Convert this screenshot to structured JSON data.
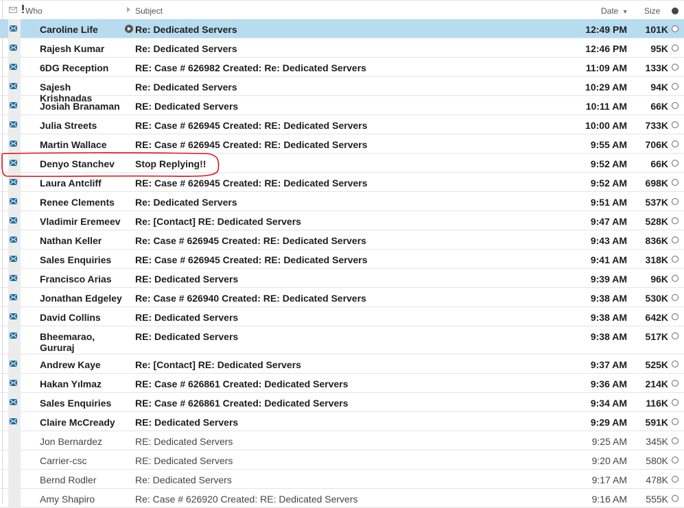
{
  "header": {
    "who_label": "Who",
    "subject_label": "Subject",
    "date_label": "Date",
    "sort_indicator": "▼",
    "size_label": "Size"
  },
  "colors": {
    "selected_row": "#b8dcef",
    "envelope_icon": "#1f6e9c",
    "annotation": "#e0101a"
  },
  "annotation": {
    "type": "hand-drawn-circle",
    "target": "Denyo Stanchev row"
  },
  "messages": [
    {
      "who": "Caroline Life",
      "subject": "Re: Dedicated Servers",
      "date": "12:49 PM",
      "size": "101K",
      "unread": true,
      "selected": true,
      "replied": true
    },
    {
      "who": "Rajesh Kumar",
      "subject": "Re: Dedicated Servers",
      "date": "12:46 PM",
      "size": "95K",
      "unread": true
    },
    {
      "who": "6DG Reception",
      "subject": "RE: Case # 626982 Created: Re: Dedicated Servers",
      "date": "11:09 AM",
      "size": "133K",
      "unread": true
    },
    {
      "who": "Sajesh Krishnadas",
      "subject": "Re: Dedicated Servers",
      "date": "10:29 AM",
      "size": "94K",
      "unread": true
    },
    {
      "who": "Josiah Branaman",
      "subject": "RE: Dedicated Servers",
      "date": "10:11 AM",
      "size": "66K",
      "unread": true
    },
    {
      "who": "Julia Streets",
      "subject": "RE: Case # 626945 Created: RE: Dedicated Servers",
      "date": "10:00 AM",
      "size": "733K",
      "unread": true
    },
    {
      "who": "Martin Wallace",
      "subject": "RE: Case # 626945 Created: RE: Dedicated Servers",
      "date": "9:55 AM",
      "size": "706K",
      "unread": true
    },
    {
      "who": "Denyo Stanchev",
      "subject": "Stop Replying!!",
      "date": "9:52 AM",
      "size": "66K",
      "unread": true,
      "circled": true
    },
    {
      "who": "Laura Antcliff",
      "subject": "RE: Case # 626945 Created: RE: Dedicated Servers",
      "date": "9:52 AM",
      "size": "698K",
      "unread": true
    },
    {
      "who": "Renee Clements",
      "subject": "Re: Dedicated Servers",
      "date": "9:51 AM",
      "size": "537K",
      "unread": true
    },
    {
      "who": "Vladimir Eremeev",
      "subject": "Re: [Contact] RE: Dedicated Servers",
      "date": "9:47 AM",
      "size": "528K",
      "unread": true
    },
    {
      "who": "Nathan Keller",
      "subject": "Re: Case # 626945 Created: RE: Dedicated Servers",
      "date": "9:43 AM",
      "size": "836K",
      "unread": true
    },
    {
      "who": "Sales Enquiries",
      "subject": "RE: Case # 626945 Created: RE: Dedicated Servers",
      "date": "9:41 AM",
      "size": "318K",
      "unread": true
    },
    {
      "who": "Francisco Arias",
      "subject": "RE: Dedicated Servers",
      "date": "9:39 AM",
      "size": "96K",
      "unread": true
    },
    {
      "who": "Jonathan Edgeley",
      "subject": "Re: Case # 626940 Created: RE: Dedicated Servers",
      "date": "9:38 AM",
      "size": "530K",
      "unread": true
    },
    {
      "who": "David Collins",
      "subject": "RE: Dedicated Servers",
      "date": "9:38 AM",
      "size": "642K",
      "unread": true
    },
    {
      "who": "Bheemarao, Gururaj",
      "subject": "RE: Dedicated Servers",
      "date": "9:38 AM",
      "size": "517K",
      "unread": true,
      "tall": true
    },
    {
      "who": "Andrew Kaye",
      "subject": "Re: [Contact] RE: Dedicated Servers",
      "date": "9:37 AM",
      "size": "525K",
      "unread": true
    },
    {
      "who": "Hakan Yılmaz",
      "subject": "RE: Case # 626861 Created: Dedicated Servers",
      "date": "9:36 AM",
      "size": "214K",
      "unread": true
    },
    {
      "who": "Sales Enquiries",
      "subject": "RE: Case # 626861 Created: Dedicated Servers",
      "date": "9:34 AM",
      "size": "116K",
      "unread": true
    },
    {
      "who": "Claire McCready",
      "subject": "RE: Dedicated Servers",
      "date": "9:29 AM",
      "size": "591K",
      "unread": true
    },
    {
      "who": "Jon Bernardez",
      "subject": "RE: Dedicated Servers",
      "date": "9:25 AM",
      "size": "345K",
      "unread": false
    },
    {
      "who": "Carrier-csc",
      "subject": "RE: Dedicated Servers",
      "date": "9:20 AM",
      "size": "580K",
      "unread": false
    },
    {
      "who": "Bernd Rodler",
      "subject": "Re: Dedicated Servers",
      "date": "9:17 AM",
      "size": "478K",
      "unread": false
    },
    {
      "who": "Amy Shapiro",
      "subject": "Re: Case # 626920 Created: RE: Dedicated Servers",
      "date": "9:16 AM",
      "size": "555K",
      "unread": false
    }
  ]
}
